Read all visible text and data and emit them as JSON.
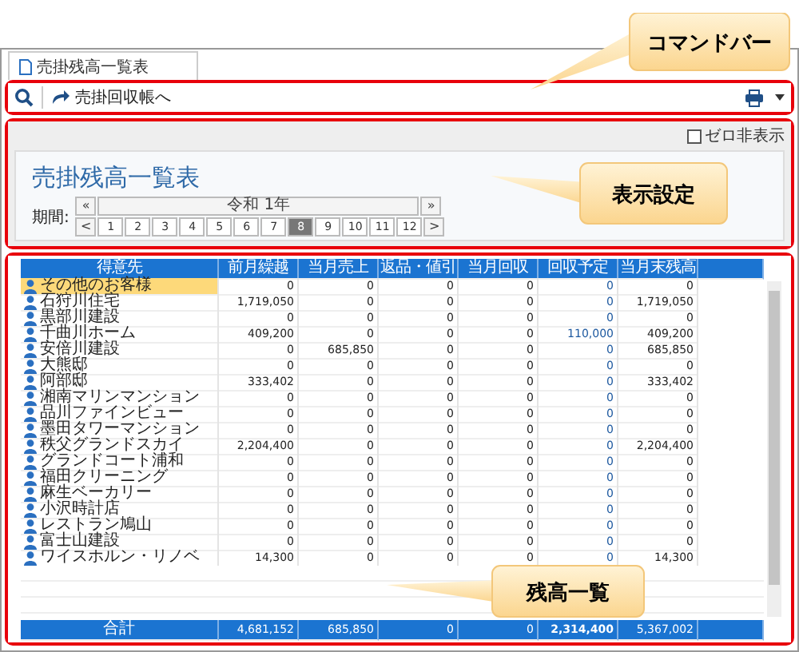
{
  "tab": {
    "label": "売掛残高一覧表",
    "selected": true
  },
  "command_bar": {
    "action": "売掛回収帳へ"
  },
  "settings": {
    "zero_hide": {
      "label": "ゼロ非表示",
      "checked": false
    },
    "title": "売掛残高一覧表",
    "period": {
      "label": "期間:",
      "year": "令和 1年",
      "prev_year": "«",
      "next_year": "»",
      "prev_month": "<",
      "next_month": ">",
      "months": [
        {
          "label": "1",
          "selected": false
        },
        {
          "label": "2",
          "selected": false
        },
        {
          "label": "3",
          "selected": false
        },
        {
          "label": "4",
          "selected": false
        },
        {
          "label": "5",
          "selected": false
        },
        {
          "label": "6",
          "selected": false
        },
        {
          "label": "7",
          "selected": false
        },
        {
          "label": "8",
          "selected": true
        },
        {
          "label": "9",
          "selected": false
        },
        {
          "label": "10",
          "selected": false
        },
        {
          "label": "11",
          "selected": false
        },
        {
          "label": "12",
          "selected": false
        }
      ]
    }
  },
  "table": {
    "columns": [
      "得意先",
      "前月繰越",
      "当月売上",
      "返品・値引",
      "当月回収",
      "回収予定",
      "当月末残高"
    ],
    "rows": [
      {
        "customer": "その他のお客様",
        "selected": true,
        "values": [
          "0",
          "0",
          "0",
          "0",
          "0",
          "0"
        ]
      },
      {
        "customer": "石狩川住宅",
        "selected": false,
        "values": [
          "1,719,050",
          "0",
          "0",
          "0",
          "0",
          "1,719,050"
        ]
      },
      {
        "customer": "黒部川建設",
        "selected": false,
        "values": [
          "0",
          "0",
          "0",
          "0",
          "0",
          "0"
        ]
      },
      {
        "customer": "千曲川ホーム",
        "selected": false,
        "values": [
          "409,200",
          "0",
          "0",
          "0",
          "110,000",
          "409,200"
        ]
      },
      {
        "customer": "安倍川建設",
        "selected": false,
        "values": [
          "0",
          "685,850",
          "0",
          "0",
          "0",
          "685,850"
        ]
      },
      {
        "customer": "大熊邸",
        "selected": false,
        "values": [
          "0",
          "0",
          "0",
          "0",
          "0",
          "0"
        ]
      },
      {
        "customer": "阿部邸",
        "selected": false,
        "values": [
          "333,402",
          "0",
          "0",
          "0",
          "0",
          "333,402"
        ]
      },
      {
        "customer": "湘南マリンマンション",
        "selected": false,
        "values": [
          "0",
          "0",
          "0",
          "0",
          "0",
          "0"
        ]
      },
      {
        "customer": "品川ファインビュー",
        "selected": false,
        "values": [
          "0",
          "0",
          "0",
          "0",
          "0",
          "0"
        ]
      },
      {
        "customer": "墨田タワーマンション",
        "selected": false,
        "values": [
          "0",
          "0",
          "0",
          "0",
          "0",
          "0"
        ]
      },
      {
        "customer": "秩父グランドスカイ",
        "selected": false,
        "values": [
          "2,204,400",
          "0",
          "0",
          "0",
          "0",
          "2,204,400"
        ]
      },
      {
        "customer": "グランドコート浦和",
        "selected": false,
        "values": [
          "0",
          "0",
          "0",
          "0",
          "0",
          "0"
        ]
      },
      {
        "customer": "福田クリーニング",
        "selected": false,
        "values": [
          "0",
          "0",
          "0",
          "0",
          "0",
          "0"
        ]
      },
      {
        "customer": "麻生ベーカリー",
        "selected": false,
        "values": [
          "0",
          "0",
          "0",
          "0",
          "0",
          "0"
        ]
      },
      {
        "customer": "小沢時計店",
        "selected": false,
        "values": [
          "0",
          "0",
          "0",
          "0",
          "0",
          "0"
        ]
      },
      {
        "customer": "レストラン鳩山",
        "selected": false,
        "values": [
          "0",
          "0",
          "0",
          "0",
          "0",
          "0"
        ]
      },
      {
        "customer": "富士山建設",
        "selected": false,
        "values": [
          "0",
          "0",
          "0",
          "0",
          "0",
          "0"
        ]
      },
      {
        "customer": "ワイスホルン・リノベ",
        "selected": false,
        "values": [
          "14,300",
          "0",
          "0",
          "0",
          "0",
          "14,300"
        ]
      }
    ],
    "total": {
      "label": "合計",
      "values": [
        "4,681,152",
        "685,850",
        "0",
        "0",
        "2,314,400",
        "5,367,002"
      ]
    }
  },
  "callouts": [
    {
      "text": "コマンドバー"
    },
    {
      "text": "表示設定"
    },
    {
      "text": "残高一覧"
    }
  ]
}
